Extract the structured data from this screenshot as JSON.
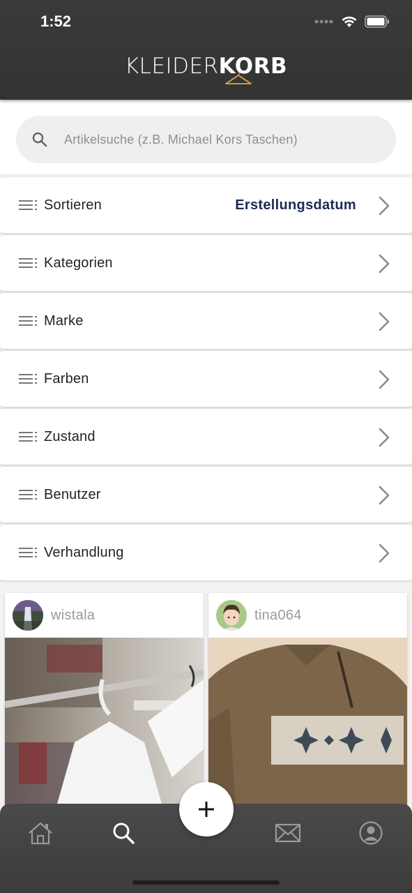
{
  "status_bar": {
    "time": "1:52"
  },
  "header": {
    "logo_thin": "KLEIDER",
    "logo_bold": "KORB",
    "accent_color": "#c79a4a"
  },
  "search": {
    "placeholder": "Artikelsuche (z.B. Michael Kors Taschen)"
  },
  "filters": [
    {
      "label": "Sortieren",
      "value": "Erstellungsdatum"
    },
    {
      "label": "Kategorien",
      "value": ""
    },
    {
      "label": "Marke",
      "value": ""
    },
    {
      "label": "Farben",
      "value": ""
    },
    {
      "label": "Zustand",
      "value": ""
    },
    {
      "label": "Benutzer",
      "value": ""
    },
    {
      "label": "Verhandlung",
      "value": ""
    }
  ],
  "cards": [
    {
      "username": "wistala",
      "avatar_icon": "waterfall-avatar",
      "image": "white-shirt-on-hanger-photo"
    },
    {
      "username": "tina064",
      "avatar_icon": "cartoon-person-avatar",
      "image": "brown-fleece-sweater-photo"
    }
  ],
  "tabbar": {
    "items": [
      "home-icon",
      "search-icon",
      "add-icon",
      "mail-icon",
      "profile-icon"
    ],
    "active": "search-icon"
  }
}
